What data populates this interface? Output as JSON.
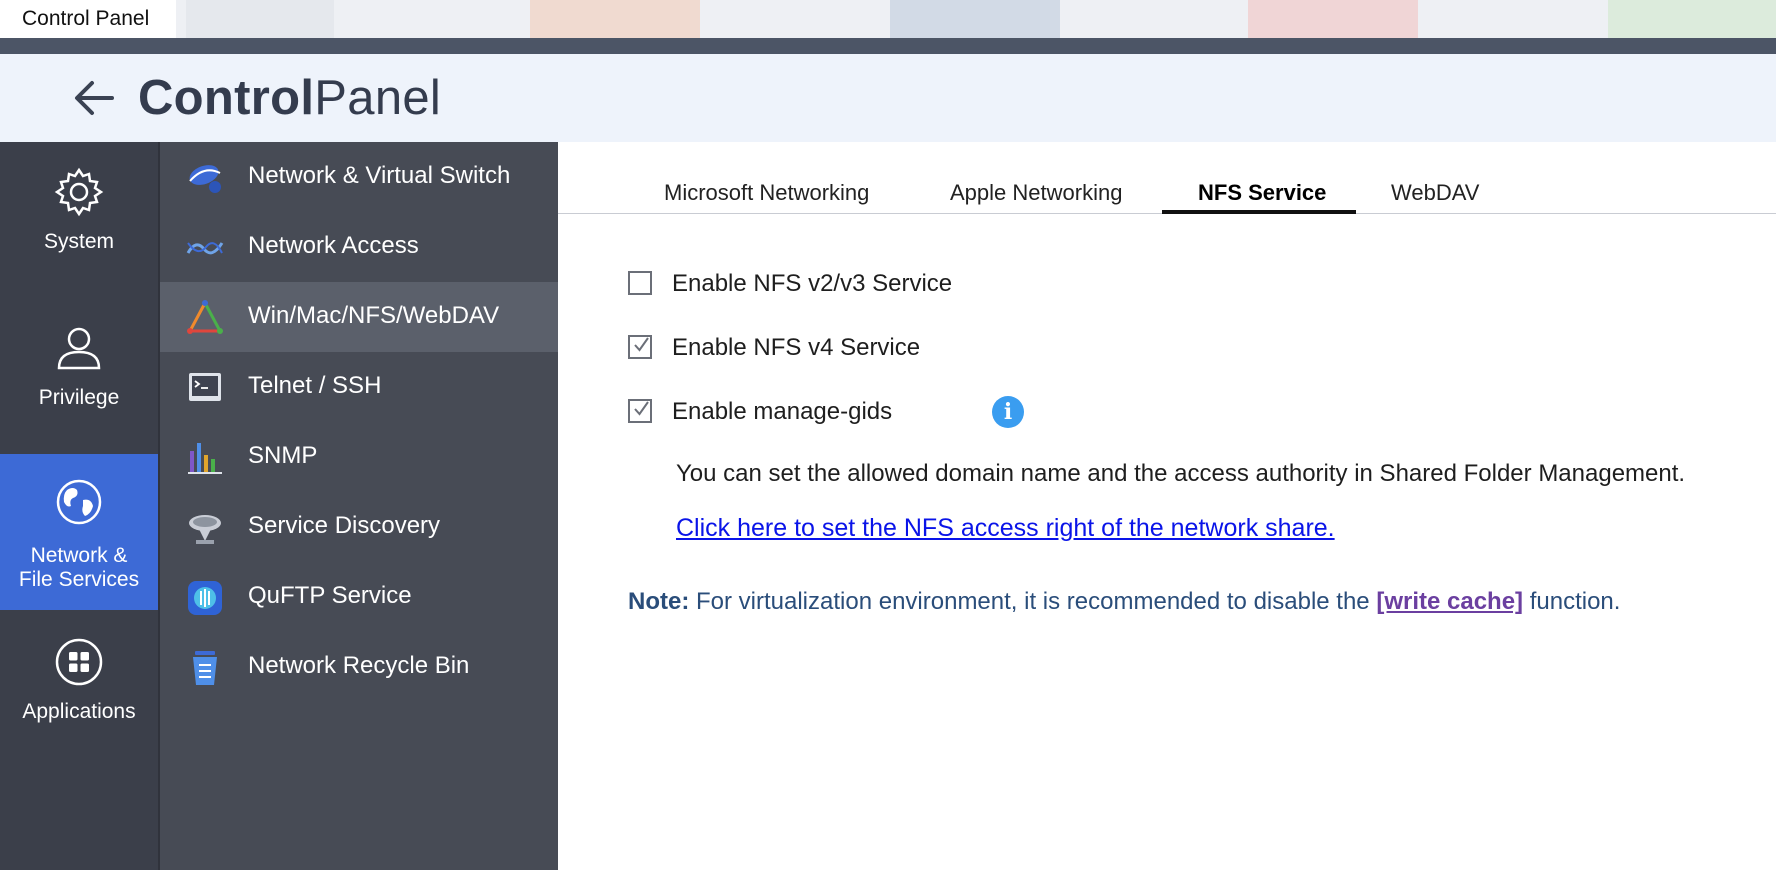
{
  "window": {
    "title": "Control Panel"
  },
  "header": {
    "brand_bold": "Control",
    "brand_light": "Panel",
    "back_icon": "arrow-left-icon"
  },
  "rail": {
    "items": [
      {
        "label": "System",
        "icon": "gear-icon",
        "active": false
      },
      {
        "label": "Privilege",
        "icon": "user-icon",
        "active": false
      },
      {
        "label_line1": "Network &",
        "label_line2": "File Services",
        "icon": "globe-icon",
        "active": true
      },
      {
        "label": "Applications",
        "icon": "grid-icon",
        "active": false
      }
    ],
    "active_color": "#3d6ad6"
  },
  "subnav": {
    "items": [
      {
        "label": "Network & Virtual Switch",
        "icon": "network-switch-icon"
      },
      {
        "label": "Network Access",
        "icon": "network-access-icon"
      },
      {
        "label": "Win/Mac/NFS/WebDAV",
        "icon": "triangle-icon",
        "active": true
      },
      {
        "label": "Telnet / SSH",
        "icon": "terminal-icon"
      },
      {
        "label": "SNMP",
        "icon": "bar-chart-icon"
      },
      {
        "label": "Service Discovery",
        "icon": "satellite-dish-icon"
      },
      {
        "label": "QuFTP Service",
        "icon": "ftp-icon"
      },
      {
        "label": "Network Recycle Bin",
        "icon": "trash-icon"
      }
    ]
  },
  "tabs": [
    {
      "label": "Microsoft Networking"
    },
    {
      "label": "Apple Networking"
    },
    {
      "label": "NFS Service",
      "active": true
    },
    {
      "label": "WebDAV"
    }
  ],
  "options": [
    {
      "label": "Enable NFS v2/v3 Service",
      "checked": false
    },
    {
      "label": "Enable NFS v4 Service",
      "checked": true
    },
    {
      "label": "Enable manage-gids",
      "checked": true,
      "info_icon": "info-icon"
    }
  ],
  "description": "You can set the allowed domain name and the access authority in Shared Folder Management.",
  "nfs_link": "Click here to set the NFS access right of the network share.",
  "note": {
    "label": "Note:",
    "text_before": " For virtualization environment, it is recommended to disable the ",
    "link": "[write cache]",
    "text_after": " function."
  },
  "colors": {
    "link": "#0a14e8",
    "note_text": "#2a4d7a",
    "write_cache_link": "#6b3fa0",
    "info": "#3a9df0"
  }
}
